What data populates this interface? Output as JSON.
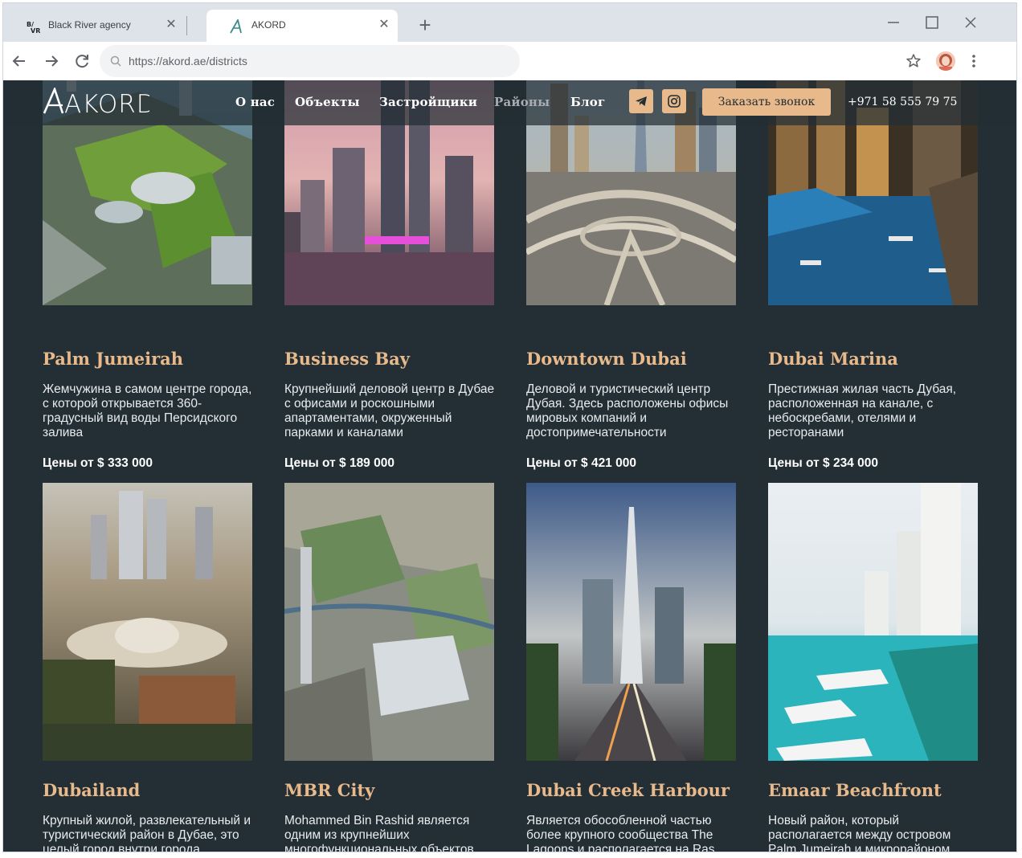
{
  "browser": {
    "tabs": [
      {
        "title": "Black River agency",
        "favicon": "bvr-logo-icon",
        "active": false
      },
      {
        "title": "AKORD",
        "favicon": "akord-a-icon",
        "active": true
      }
    ],
    "url": "https://akord.ae/districts"
  },
  "site": {
    "logo_text": "AKORD",
    "nav": [
      {
        "label": "О нас"
      },
      {
        "label": "Объекты"
      },
      {
        "label": "Застройщики"
      },
      {
        "label": "Районы"
      },
      {
        "label": "Блог"
      }
    ],
    "social": [
      "telegram-icon",
      "instagram-icon"
    ],
    "cta_label": "Заказать звонок",
    "phone": "+971 58 555 79 75"
  },
  "districts": [
    {
      "name": "Palm Jumeirah",
      "desc": "Жемчужина в самом центре города, с которой открывается 360-градусный вид воды Персидского залива",
      "price": "Цены от $ 333 000"
    },
    {
      "name": "Business Bay",
      "desc": "Крупнейший деловой центр в Дубае с офисами и роскошными апартаментами, окруженный парками и каналами",
      "price": "Цены от $ 189 000"
    },
    {
      "name": "Downtown Dubai",
      "desc": "Деловой и туристический центр Дубая. Здесь расположены офисы мировых компаний и достопримечательности",
      "price": "Цены от $ 421 000"
    },
    {
      "name": "Dubai Marina",
      "desc": "Престижная жилая часть Дубая, расположенная на канале, с небоскребами, отелями и ресторанами",
      "price": "Цены от $ 234 000"
    },
    {
      "name": "Dubailand",
      "desc": "Крупный жилой, развлекательный и туристический район в Дубае, это целый город внутри города"
    },
    {
      "name": "MBR City",
      "desc": "Mohammed Bin Rashid является одним из крупнейших многофункциональных объектов"
    },
    {
      "name": "Dubai Creek Harbour",
      "desc": "Является обособленной частью более крупного сообщества The Lagoons и располагается на Ras"
    },
    {
      "name": "Emaar Beachfront",
      "desc": "Новый район, который располагается между островом Palm Jumeirah и микрорайоном"
    }
  ],
  "colors": {
    "accent": "#e7b98b",
    "page_bg": "#232e35",
    "text": "#e9ecee"
  }
}
